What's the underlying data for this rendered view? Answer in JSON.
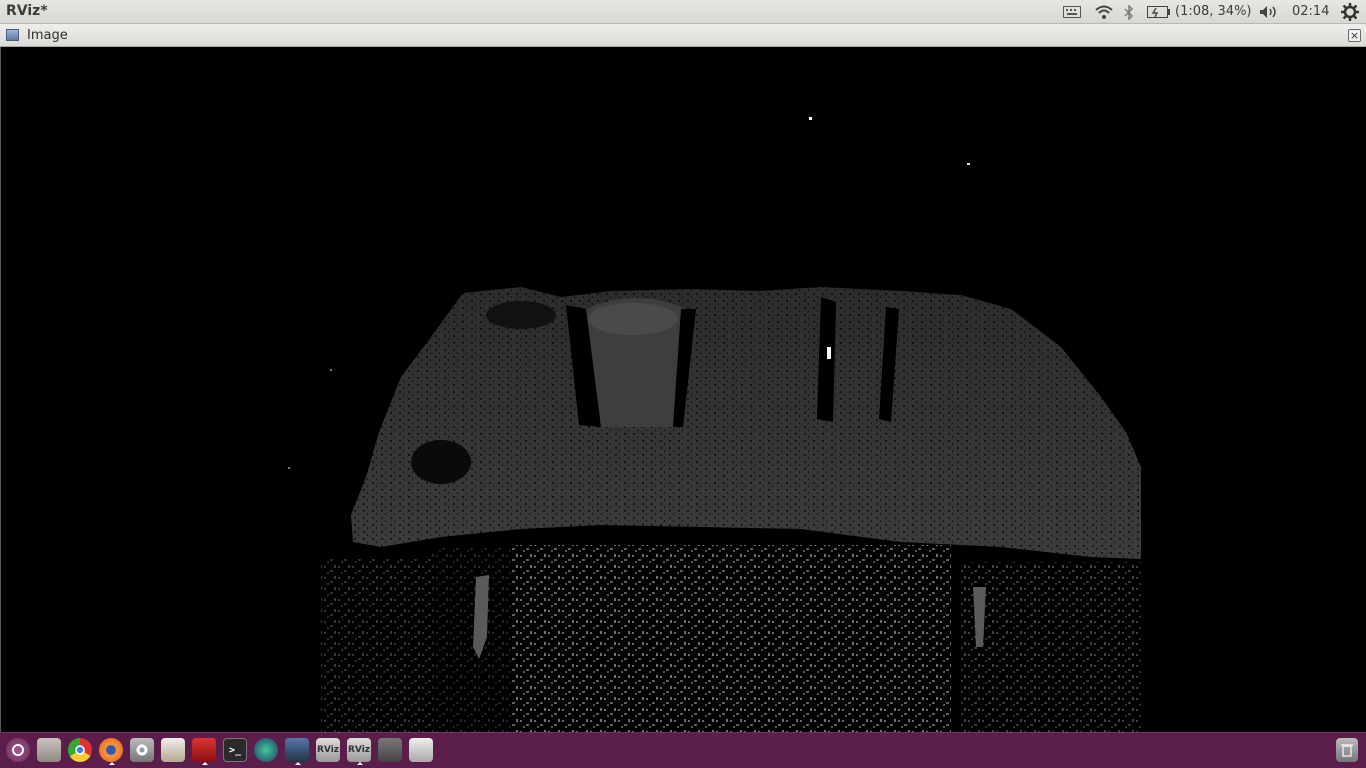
{
  "top_panel": {
    "app_title": "RViz*",
    "battery_status": "(1:08, 34%)",
    "clock": "02:14",
    "icons": [
      "keyboard-icon",
      "wifi-icon",
      "bluetooth-icon",
      "battery-icon",
      "volume-icon",
      "settings-gear-icon"
    ]
  },
  "window": {
    "title": "Image",
    "close_glyph": "×"
  },
  "taskbar": {
    "items": [
      {
        "name": "ubuntu-dash",
        "label": ""
      },
      {
        "name": "files",
        "label": ""
      },
      {
        "name": "chrome",
        "label": ""
      },
      {
        "name": "firefox",
        "label": ""
      },
      {
        "name": "system-settings",
        "label": ""
      },
      {
        "name": "software",
        "label": ""
      },
      {
        "name": "screen-recorder",
        "label": ""
      },
      {
        "name": "terminal",
        "label": ">_"
      },
      {
        "name": "globe-app",
        "label": ""
      },
      {
        "name": "editor",
        "label": ""
      },
      {
        "name": "rviz-1",
        "label": "RViz"
      },
      {
        "name": "rviz-2",
        "label": "RViz"
      },
      {
        "name": "window-app",
        "label": ""
      },
      {
        "name": "drive",
        "label": ""
      }
    ],
    "trash": "trash-icon"
  },
  "colors": {
    "taskbar_bg": "#5b1d4a",
    "depth_gray": "#3a3a3a",
    "depth_noise": "#6a6a6a"
  }
}
